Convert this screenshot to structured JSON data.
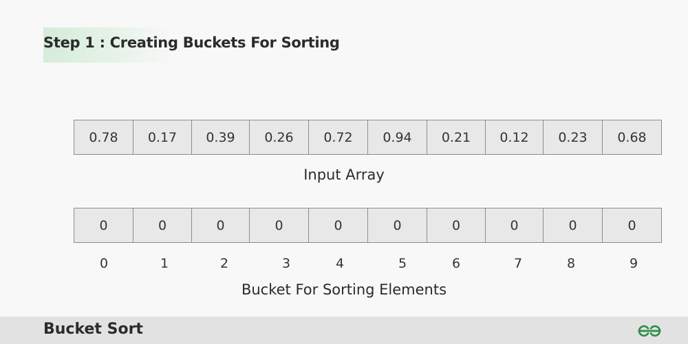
{
  "header": {
    "step_title": "Step 1 : Creating Buckets For Sorting"
  },
  "input_array": {
    "values": [
      "0.78",
      "0.17",
      "0.39",
      "0.26",
      "0.72",
      "0.94",
      "0.21",
      "0.12",
      "0.23",
      "0.68"
    ],
    "caption": "Input Array"
  },
  "bucket_array": {
    "values": [
      "0",
      "0",
      "0",
      "0",
      "0",
      "0",
      "0",
      "0",
      "0",
      "0"
    ],
    "indices": [
      "0",
      "1",
      "2",
      "3",
      "4",
      "5",
      "6",
      "7",
      "8",
      "9"
    ],
    "caption": "Bucket For Sorting Elements"
  },
  "footer": {
    "title": "Bucket Sort",
    "logo_icon": "gfg-logo-icon"
  },
  "colors": {
    "accent_green": "#2f8d46",
    "banner_green": "#d6ecd9",
    "cell_fill": "#e8e8e8",
    "cell_border": "#8c8c8c"
  }
}
